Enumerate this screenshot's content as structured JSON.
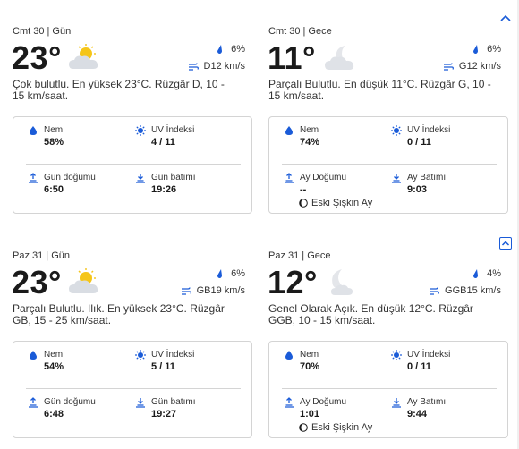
{
  "blocks": [
    {
      "day": {
        "period": "Cmt 30 | Gün",
        "temp": "23°",
        "icon": "partly-sunny-icon",
        "precip": "6%",
        "wind": "D12 km/s",
        "desc": "Çok bulutlu. En yüksek 23°C. Rüzgâr D, 10 - 15 km/saat.",
        "humidity_label": "Nem",
        "humidity": "58%",
        "uv_label": "UV İndeksi",
        "uv": "4 / 11",
        "rise_label": "Gün doğumu",
        "rise": "6:50",
        "set_label": "Gün batımı",
        "set": "19:26"
      },
      "night": {
        "period": "Cmt 30 | Gece",
        "temp": "11°",
        "icon": "moon-cloud-icon",
        "precip": "6%",
        "wind": "G12 km/s",
        "desc": "Parçalı Bulutlu. En düşük 11°C. Rüzgâr G, 10 - 15 km/saat.",
        "humidity_label": "Nem",
        "humidity": "74%",
        "uv_label": "UV İndeksi",
        "uv": "0 / 11",
        "rise_label": "Ay Doğumu",
        "rise": "--",
        "set_label": "Ay Batımı",
        "set": "9:03",
        "moon_phase": "Eski Şişkin Ay"
      }
    },
    {
      "day": {
        "period": "Paz 31 | Gün",
        "temp": "23°",
        "icon": "partly-sunny-icon",
        "precip": "6%",
        "wind": "GB19 km/s",
        "desc": "Parçalı Bulutlu. Ilık. En yüksek 23°C. Rüzgâr GB, 15 - 25 km/saat.",
        "humidity_label": "Nem",
        "humidity": "54%",
        "uv_label": "UV İndeksi",
        "uv": "5 / 11",
        "rise_label": "Gün doğumu",
        "rise": "6:48",
        "set_label": "Gün batımı",
        "set": "19:27"
      },
      "night": {
        "period": "Paz 31 | Gece",
        "temp": "12°",
        "icon": "moon-cloud-icon",
        "precip": "4%",
        "wind": "GGB15 km/s",
        "desc": "Genel Olarak Açık. En düşük 12°C. Rüzgâr GGB, 10 - 15 km/saat.",
        "humidity_label": "Nem",
        "humidity": "70%",
        "uv_label": "UV İndeksi",
        "uv": "0 / 11",
        "rise_label": "Ay Doğumu",
        "rise": "1:01",
        "set_label": "Ay Batımı",
        "set": "9:44",
        "moon_phase": "Eski Şişkin Ay"
      }
    }
  ],
  "colors": {
    "accent": "#1a5bd8",
    "sun": "#f5c518",
    "cloud": "#d9dde3"
  }
}
